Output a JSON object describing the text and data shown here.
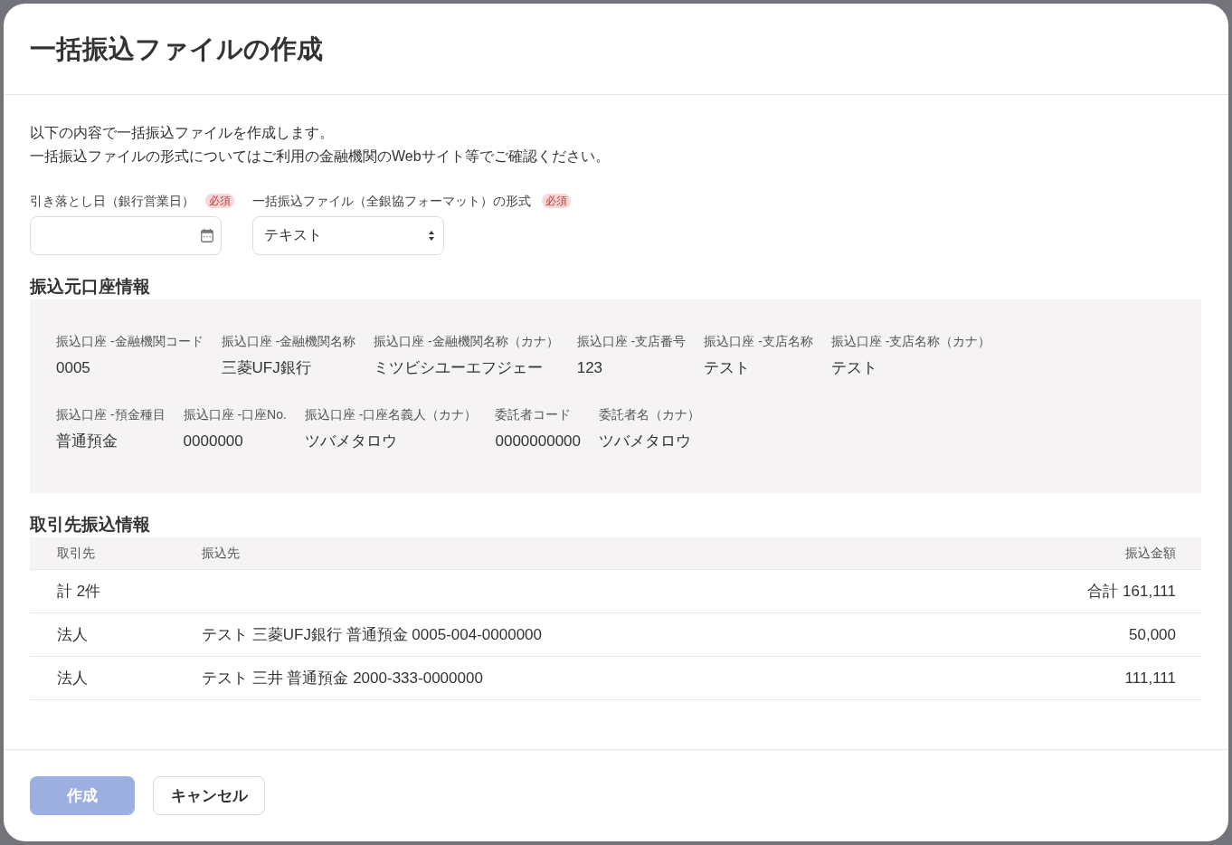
{
  "dialog": {
    "title": "一括振込ファイルの作成"
  },
  "intro": [
    "以下の内容で一括振込ファイルを作成します。",
    "一括振込ファイルの形式についてはご利用の金融機関のWebサイト等でご確認ください。"
  ],
  "fields": [
    {
      "kind": "date",
      "label": "引き落とし日（銀行営業日）",
      "badge": "必須"
    },
    {
      "kind": "select",
      "label": "一括振込ファイル（全銀協フォーマット）の形式",
      "badge": "必須",
      "value": "テキスト"
    }
  ],
  "source_account": {
    "heading": "振込元口座情報",
    "groups": [
      {
        "items": [
          {
            "label": "振込口座 -金融機関コード",
            "value": "0005"
          },
          {
            "label": "振込口座 -金融機関名称",
            "value": "三菱UFJ銀行"
          },
          {
            "label": "振込口座 -金融機関名称（カナ）",
            "value": "ミツビシユーエフジェー"
          },
          {
            "label": "振込口座 -支店番号",
            "value": "123"
          },
          {
            "label": "振込口座 -支店名称",
            "value": "テスト"
          },
          {
            "label": "振込口座 -支店名称（カナ）",
            "value": "テスト"
          }
        ]
      },
      {
        "items": [
          {
            "label": "振込口座 -預金種目",
            "value": "普通預金"
          },
          {
            "label": "振込口座 -口座No.",
            "value": "0000000"
          },
          {
            "label": "振込口座 -口座名義人（カナ）",
            "value": "ツバメタロウ"
          },
          {
            "label": "委託者コード",
            "value": "0000000000"
          },
          {
            "label": "委託者名（カナ）",
            "value": "ツバメタロウ"
          }
        ]
      }
    ]
  },
  "transfers": {
    "heading": "取引先振込情報",
    "columns": [
      "取引先",
      "振込先",
      "振込金額"
    ],
    "summary": {
      "count": "計 2件",
      "total": "合計 161,111"
    },
    "rows": [
      [
        "法人",
        "テスト 三菱UFJ銀行 普通預金 0005-004-0000000",
        "50,000"
      ],
      [
        "法人",
        "テスト 三井 普通預金 2000-333-0000000",
        "111,111"
      ]
    ]
  },
  "buttons": [
    {
      "kind": "primary",
      "label": "作成",
      "disabled": true
    },
    {
      "kind": "secondary",
      "label": "キャンセル",
      "disabled": false
    }
  ]
}
